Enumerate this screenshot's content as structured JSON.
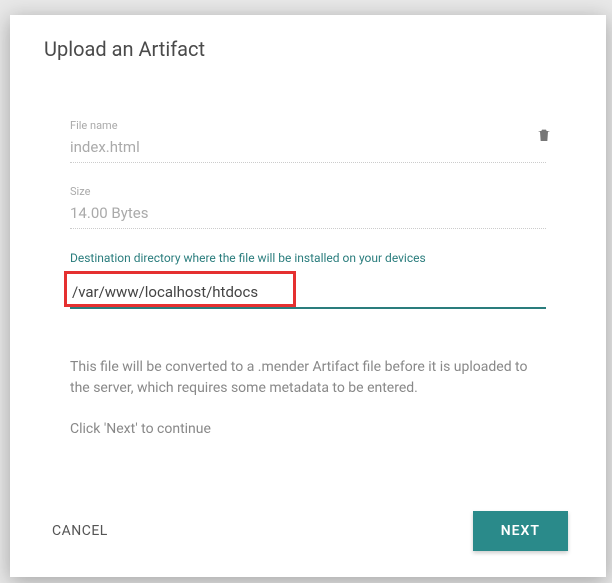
{
  "modal": {
    "title": "Upload an Artifact",
    "fileNameLabel": "File name",
    "fileNameValue": "index.html",
    "sizeLabel": "Size",
    "sizeValue": "14.00 Bytes",
    "destinationLabel": "Destination directory where the file will be installed on your devices",
    "destinationValue": "/var/www/localhost/htdocs",
    "infoText1": "This file will be converted to a .mender Artifact file before it is uploaded to the server, which requires some metadata to be entered.",
    "infoText2": "Click 'Next' to continue",
    "cancelLabel": "CANCEL",
    "nextLabel": "NEXT"
  }
}
